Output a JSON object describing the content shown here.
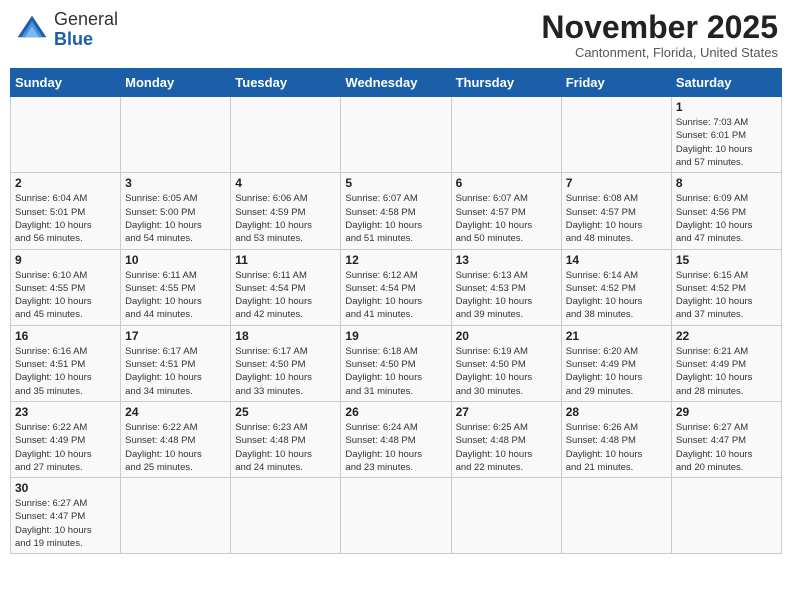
{
  "header": {
    "logo_general": "General",
    "logo_blue": "Blue",
    "month_title": "November 2025",
    "subtitle": "Cantonment, Florida, United States"
  },
  "weekdays": [
    "Sunday",
    "Monday",
    "Tuesday",
    "Wednesday",
    "Thursday",
    "Friday",
    "Saturday"
  ],
  "weeks": [
    [
      {
        "day": "",
        "info": ""
      },
      {
        "day": "",
        "info": ""
      },
      {
        "day": "",
        "info": ""
      },
      {
        "day": "",
        "info": ""
      },
      {
        "day": "",
        "info": ""
      },
      {
        "day": "",
        "info": ""
      },
      {
        "day": "1",
        "info": "Sunrise: 7:03 AM\nSunset: 6:01 PM\nDaylight: 10 hours\nand 57 minutes."
      }
    ],
    [
      {
        "day": "2",
        "info": "Sunrise: 6:04 AM\nSunset: 5:01 PM\nDaylight: 10 hours\nand 56 minutes."
      },
      {
        "day": "3",
        "info": "Sunrise: 6:05 AM\nSunset: 5:00 PM\nDaylight: 10 hours\nand 54 minutes."
      },
      {
        "day": "4",
        "info": "Sunrise: 6:06 AM\nSunset: 4:59 PM\nDaylight: 10 hours\nand 53 minutes."
      },
      {
        "day": "5",
        "info": "Sunrise: 6:07 AM\nSunset: 4:58 PM\nDaylight: 10 hours\nand 51 minutes."
      },
      {
        "day": "6",
        "info": "Sunrise: 6:07 AM\nSunset: 4:57 PM\nDaylight: 10 hours\nand 50 minutes."
      },
      {
        "day": "7",
        "info": "Sunrise: 6:08 AM\nSunset: 4:57 PM\nDaylight: 10 hours\nand 48 minutes."
      },
      {
        "day": "8",
        "info": "Sunrise: 6:09 AM\nSunset: 4:56 PM\nDaylight: 10 hours\nand 47 minutes."
      }
    ],
    [
      {
        "day": "9",
        "info": "Sunrise: 6:10 AM\nSunset: 4:55 PM\nDaylight: 10 hours\nand 45 minutes."
      },
      {
        "day": "10",
        "info": "Sunrise: 6:11 AM\nSunset: 4:55 PM\nDaylight: 10 hours\nand 44 minutes."
      },
      {
        "day": "11",
        "info": "Sunrise: 6:11 AM\nSunset: 4:54 PM\nDaylight: 10 hours\nand 42 minutes."
      },
      {
        "day": "12",
        "info": "Sunrise: 6:12 AM\nSunset: 4:54 PM\nDaylight: 10 hours\nand 41 minutes."
      },
      {
        "day": "13",
        "info": "Sunrise: 6:13 AM\nSunset: 4:53 PM\nDaylight: 10 hours\nand 39 minutes."
      },
      {
        "day": "14",
        "info": "Sunrise: 6:14 AM\nSunset: 4:52 PM\nDaylight: 10 hours\nand 38 minutes."
      },
      {
        "day": "15",
        "info": "Sunrise: 6:15 AM\nSunset: 4:52 PM\nDaylight: 10 hours\nand 37 minutes."
      }
    ],
    [
      {
        "day": "16",
        "info": "Sunrise: 6:16 AM\nSunset: 4:51 PM\nDaylight: 10 hours\nand 35 minutes."
      },
      {
        "day": "17",
        "info": "Sunrise: 6:17 AM\nSunset: 4:51 PM\nDaylight: 10 hours\nand 34 minutes."
      },
      {
        "day": "18",
        "info": "Sunrise: 6:17 AM\nSunset: 4:50 PM\nDaylight: 10 hours\nand 33 minutes."
      },
      {
        "day": "19",
        "info": "Sunrise: 6:18 AM\nSunset: 4:50 PM\nDaylight: 10 hours\nand 31 minutes."
      },
      {
        "day": "20",
        "info": "Sunrise: 6:19 AM\nSunset: 4:50 PM\nDaylight: 10 hours\nand 30 minutes."
      },
      {
        "day": "21",
        "info": "Sunrise: 6:20 AM\nSunset: 4:49 PM\nDaylight: 10 hours\nand 29 minutes."
      },
      {
        "day": "22",
        "info": "Sunrise: 6:21 AM\nSunset: 4:49 PM\nDaylight: 10 hours\nand 28 minutes."
      }
    ],
    [
      {
        "day": "23",
        "info": "Sunrise: 6:22 AM\nSunset: 4:49 PM\nDaylight: 10 hours\nand 27 minutes."
      },
      {
        "day": "24",
        "info": "Sunrise: 6:22 AM\nSunset: 4:48 PM\nDaylight: 10 hours\nand 25 minutes."
      },
      {
        "day": "25",
        "info": "Sunrise: 6:23 AM\nSunset: 4:48 PM\nDaylight: 10 hours\nand 24 minutes."
      },
      {
        "day": "26",
        "info": "Sunrise: 6:24 AM\nSunset: 4:48 PM\nDaylight: 10 hours\nand 23 minutes."
      },
      {
        "day": "27",
        "info": "Sunrise: 6:25 AM\nSunset: 4:48 PM\nDaylight: 10 hours\nand 22 minutes."
      },
      {
        "day": "28",
        "info": "Sunrise: 6:26 AM\nSunset: 4:48 PM\nDaylight: 10 hours\nand 21 minutes."
      },
      {
        "day": "29",
        "info": "Sunrise: 6:27 AM\nSunset: 4:47 PM\nDaylight: 10 hours\nand 20 minutes."
      }
    ],
    [
      {
        "day": "30",
        "info": "Sunrise: 6:27 AM\nSunset: 4:47 PM\nDaylight: 10 hours\nand 19 minutes."
      },
      {
        "day": "",
        "info": ""
      },
      {
        "day": "",
        "info": ""
      },
      {
        "day": "",
        "info": ""
      },
      {
        "day": "",
        "info": ""
      },
      {
        "day": "",
        "info": ""
      },
      {
        "day": "",
        "info": ""
      }
    ]
  ]
}
